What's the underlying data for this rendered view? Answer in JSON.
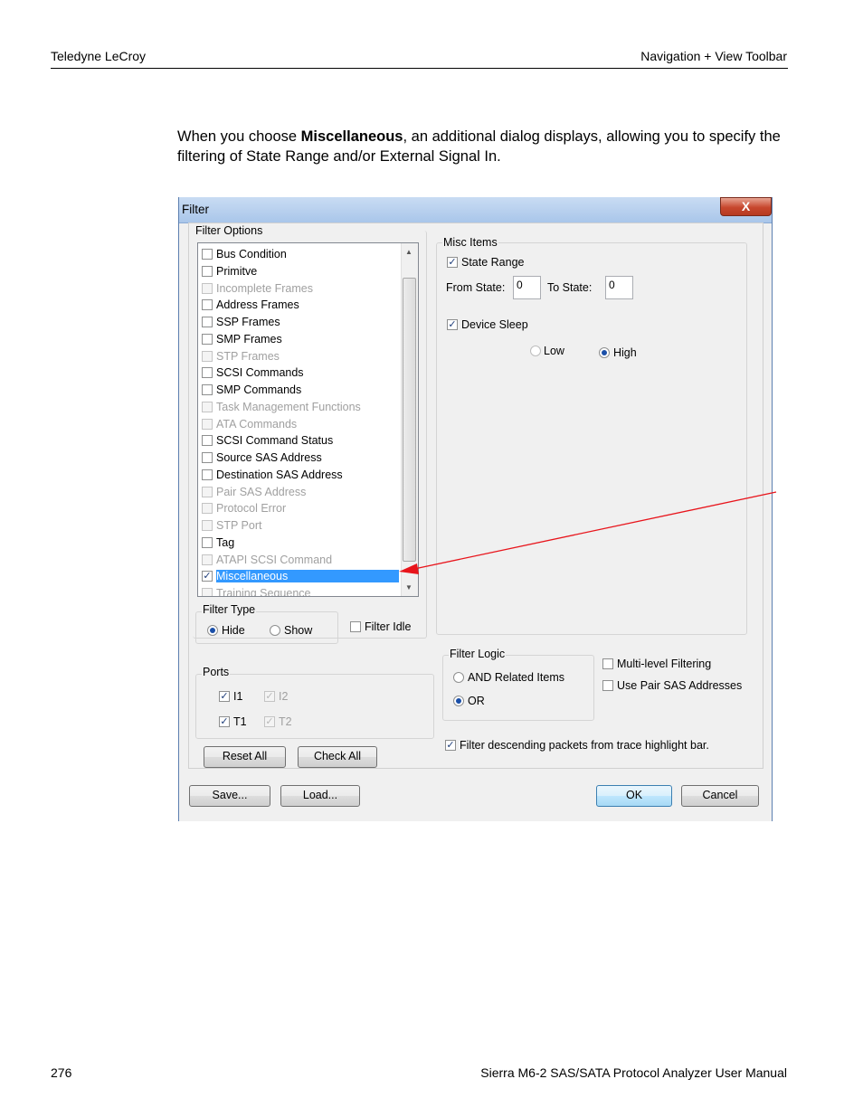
{
  "header": {
    "left": "Teledyne LeCroy",
    "right": "Navigation + View Toolbar"
  },
  "intro": {
    "before": "When you choose ",
    "bold": "Miscellaneous",
    "after": ", an additional dialog displays, allowing you to specify the filtering of State Range and/or External Signal In."
  },
  "dialog": {
    "title": "Filter",
    "close": "X",
    "filter_options_label": "Filter Options",
    "items": [
      {
        "label": "Bus Condition",
        "checked": false,
        "enabled": true
      },
      {
        "label": "Primitve",
        "checked": false,
        "enabled": true
      },
      {
        "label": "Incomplete Frames",
        "checked": false,
        "enabled": false
      },
      {
        "label": "Address Frames",
        "checked": false,
        "enabled": true
      },
      {
        "label": "SSP Frames",
        "checked": false,
        "enabled": true
      },
      {
        "label": "SMP Frames",
        "checked": false,
        "enabled": true
      },
      {
        "label": "STP Frames",
        "checked": false,
        "enabled": false
      },
      {
        "label": "SCSI Commands",
        "checked": false,
        "enabled": true
      },
      {
        "label": "SMP Commands",
        "checked": false,
        "enabled": true
      },
      {
        "label": "Task Management Functions",
        "checked": false,
        "enabled": false
      },
      {
        "label": "ATA Commands",
        "checked": false,
        "enabled": false
      },
      {
        "label": "SCSI Command Status",
        "checked": false,
        "enabled": true
      },
      {
        "label": "Source SAS Address",
        "checked": false,
        "enabled": true
      },
      {
        "label": "Destination SAS Address",
        "checked": false,
        "enabled": true
      },
      {
        "label": "Pair SAS Address",
        "checked": false,
        "enabled": false
      },
      {
        "label": "Protocol Error",
        "checked": false,
        "enabled": false
      },
      {
        "label": "STP Port",
        "checked": false,
        "enabled": false
      },
      {
        "label": "Tag",
        "checked": false,
        "enabled": true
      },
      {
        "label": "ATAPI SCSI Command",
        "checked": false,
        "enabled": false
      },
      {
        "label": "Miscellaneous",
        "checked": true,
        "enabled": true,
        "selected": true
      },
      {
        "label": "Training Sequence",
        "checked": false,
        "enabled": false
      }
    ],
    "filter_type": {
      "label": "Filter Type",
      "hide": "Hide",
      "show": "Show",
      "selected": "Hide"
    },
    "filter_idle": "Filter Idle",
    "ports": {
      "label": "Ports",
      "i1": "I1",
      "i2": "I2",
      "t1": "T1",
      "t2": "T2"
    },
    "reset_all": "Reset All",
    "check_all": "Check All",
    "misc": {
      "label": "Misc Items",
      "state_range": "State Range",
      "from_state": "From State:",
      "from_value": "0",
      "to_state": "To State:",
      "to_value": "0",
      "device_sleep": "Device Sleep",
      "low": "Low",
      "high": "High",
      "selected": "High"
    },
    "filter_logic": {
      "label": "Filter Logic",
      "and": "AND Related Items",
      "or": "OR",
      "selected": "OR"
    },
    "multi_level": "Multi-level Filtering",
    "use_pair": "Use Pair SAS Addresses",
    "filter_desc": "Filter descending packets from trace highlight bar.",
    "save": "Save...",
    "load": "Load...",
    "ok": "OK",
    "cancel": "Cancel"
  },
  "annotation_color": "#e8141b",
  "footer": {
    "left": "276",
    "right": "Sierra M6-2 SAS/SATA Protocol Analyzer User Manual"
  }
}
